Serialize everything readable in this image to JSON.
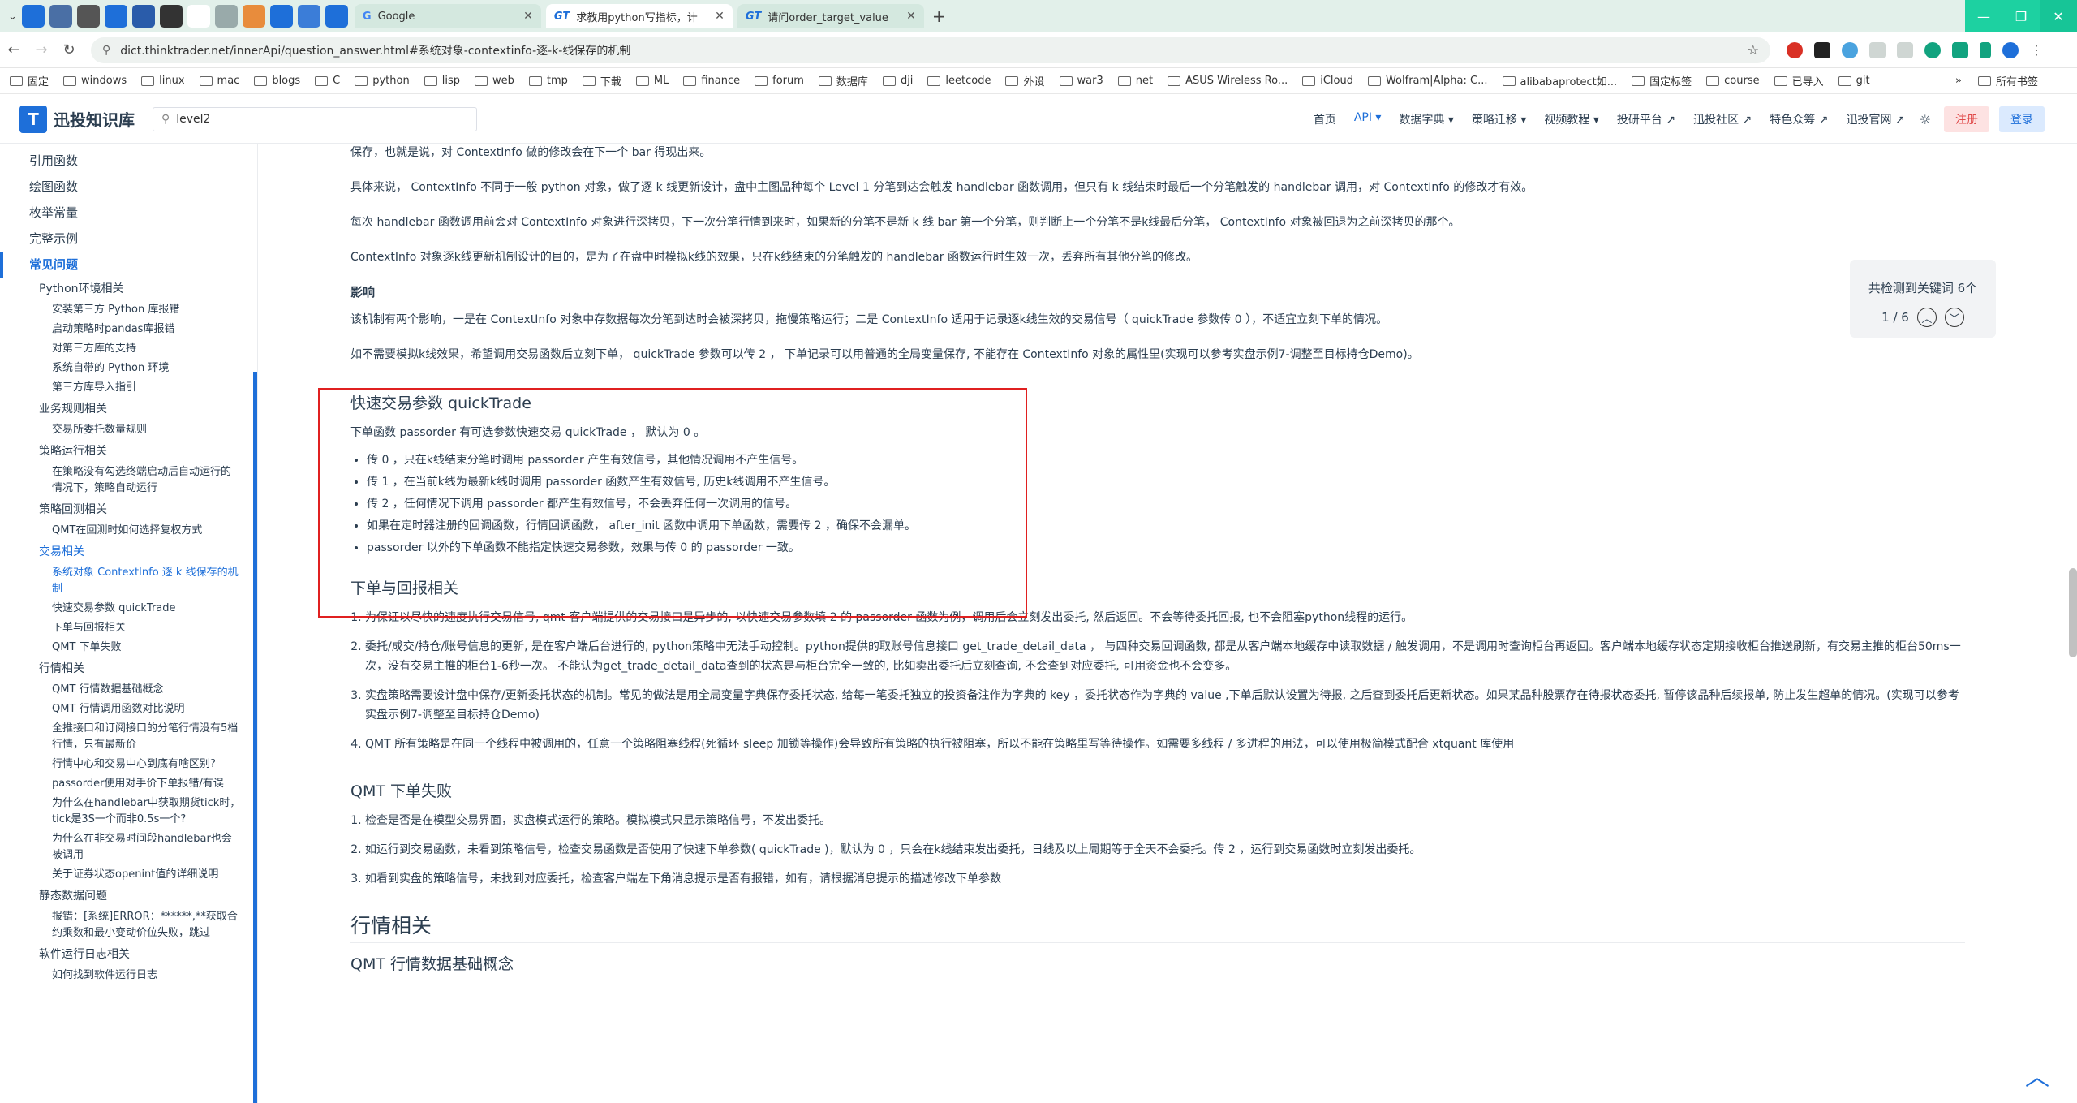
{
  "browser": {
    "tabs": [
      {
        "label": "Google",
        "active": false
      },
      {
        "label": "求教用python写指标，计算出…",
        "active": true
      },
      {
        "label": "请问order_target_value的使用…",
        "active": false
      }
    ],
    "pinned_tabs": [
      "",
      "",
      "",
      "",
      "",
      "",
      "",
      "",
      "",
      "",
      "",
      ""
    ],
    "url": "dict.thinktrader.net/innerApi/question_answer.html#系统对象-contextinfo-逐-k-线保存的机制",
    "bookmarks": [
      "固定",
      "windows",
      "linux",
      "mac",
      "blogs",
      "C",
      "python",
      "lisp",
      "web",
      "tmp",
      "下载",
      "ML",
      "finance",
      "forum",
      "数据库",
      "dji",
      "leetcode",
      "外设",
      "war3",
      "net",
      "ASUS Wireless Ro...",
      "iCloud",
      "Wolfram|Alpha: C...",
      "alibabaprotect如...",
      "固定标签",
      "course",
      "已导入",
      "git"
    ],
    "bookmarks_all": "所有书签"
  },
  "site": {
    "logo_text": "迅投知识库",
    "search_value": "level2",
    "nav": [
      {
        "label": "首页",
        "active": false
      },
      {
        "label": "API ▾",
        "active": true
      },
      {
        "label": "数据字典 ▾",
        "active": false
      },
      {
        "label": "策略迁移 ▾",
        "active": false
      },
      {
        "label": "视频教程 ▾",
        "active": false
      },
      {
        "label": "投研平台 ↗",
        "active": false
      },
      {
        "label": "迅投社区 ↗",
        "active": false
      },
      {
        "label": "特色众筹 ↗",
        "active": false
      },
      {
        "label": "迅投官网 ↗",
        "active": false
      }
    ],
    "register": "注册",
    "login": "登录"
  },
  "sidebar": {
    "top_items": [
      "引用函数",
      "绘图函数",
      "枚举常量",
      "完整示例",
      "常见问题"
    ],
    "groups": [
      {
        "title": "Python环境相关",
        "leaves": [
          "安装第三方 Python 库报错",
          "启动策略时pandas库报错",
          "对第三方库的支持",
          "系统自带的 Python 环境",
          "第三方库导入指引"
        ]
      },
      {
        "title": "业务规则相关",
        "leaves": [
          "交易所委托数量规则"
        ]
      },
      {
        "title": "策略运行相关",
        "leaves": [
          "在策略没有勾选终端启动后自动运行的情况下，策略自动运行"
        ]
      },
      {
        "title": "策略回测相关",
        "leaves": [
          "QMT在回测时如何选择复权方式"
        ]
      },
      {
        "title": "交易相关",
        "leaves": [
          "系统对象 ContextInfo 逐 k 线保存的机制",
          "快速交易参数 quickTrade",
          "下单与回报相关",
          "QMT 下单失败"
        ]
      },
      {
        "title": "行情相关",
        "leaves": [
          "QMT 行情数据基础概念",
          "QMT 行情调用函数对比说明",
          "全推接口和订阅接口的分笔行情没有5档行情，只有最新价",
          "行情中心和交易中心到底有啥区别?",
          "passorder使用对手价下单报错/有误",
          "为什么在handlebar中获取期货tick时，tick是3S一个而非0.5s一个?",
          "为什么在非交易时间段handlebar也会被调用",
          "关于证券状态openint值的详细说明"
        ]
      },
      {
        "title": "静态数据问题",
        "leaves": [
          "报错：[系统]ERROR：******,**获取合约乘数和最小变动价位失败，跳过"
        ]
      },
      {
        "title": "软件运行日志相关",
        "leaves": [
          "如何找到软件运行日志"
        ]
      }
    ]
  },
  "content": {
    "p0": "保存，也就是说，对 ContextInfo 做的修改会在下一个 bar 得现出来。",
    "p1": "具体来说， ContextInfo 不同于一般 python 对象，做了逐 k 线更新设计，盘中主图品种每个 Level 1 分笔到达会触发 handlebar 函数调用，但只有 k 线结束时最后一个分笔触发的 handlebar 调用，对 ContextInfo 的修改才有效。",
    "p2": "每次 handlebar 函数调用前会对 ContextInfo 对象进行深拷贝，下一次分笔行情到来时，如果新的分笔不是新 k 线 bar 第一个分笔，则判断上一个分笔不是k线最后分笔， ContextInfo 对象被回退为之前深拷贝的那个。",
    "p3": "ContextInfo 对象逐k线更新机制设计的目的，是为了在盘中时模拟k线的效果，只在k线结束的分笔触发的 handlebar 函数运行时生效一次，丢弃所有其他分笔的修改。",
    "impact_title": "影响",
    "p4": "该机制有两个影响，一是在 ContextInfo 对象中存数据每次分笔到达时会被深拷贝，拖慢策略运行；二是 ContextInfo 适用于记录逐k线生效的交易信号（ quickTrade 参数传 0 ），不适宜立刻下单的情况。",
    "p5": "如不需要模拟k线效果，希望调用交易函数后立刻下单， quickTrade 参数可以传 2 ， 下单记录可以用普通的全局变量保存, 不能存在 ContextInfo 对象的属性里(实现可以参考实盘示例7-调整至目标持仓Demo)。",
    "qt_title": "快速交易参数 quickTrade",
    "qt_intro": "下单函数 passorder 有可选参数快速交易 quickTrade ， 默认为 0 。",
    "qt_items": [
      "传 0 ，只在k线结束分笔时调用 passorder 产生有效信号，其他情况调用不产生信号。",
      "传 1 ，在当前k线为最新k线时调用 passorder 函数产生有效信号, 历史k线调用不产生信号。",
      "传 2 ，任何情况下调用 passorder 都产生有效信号，不会丢弃任何一次调用的信号。",
      "如果在定时器注册的回调函数，行情回调函数， after_init 函数中调用下单函数，需要传 2 ，确保不会漏单。",
      "passorder 以外的下单函数不能指定快速交易参数，效果与传 0 的 passorder 一致。"
    ],
    "order_title": "下单与回报相关",
    "order_items": [
      "为保证以尽快的速度执行交易信号, qmt 客户端提供的交易接口是异步的, 以快速交易参数填 2 的 passorder 函数为例，调用后会立刻发出委托, 然后返回。不会等待委托回报, 也不会阻塞python线程的运行。",
      "委托/成交/持仓/账号信息的更新, 是在客户端后台进行的, python策略中无法手动控制。python提供的取账号信息接口 get_trade_detail_data ， 与四种交易回调函数, 都是从客户端本地缓存中读取数据 / 触发调用，不是调用时查询柜台再返回。客户端本地缓存状态定期接收柜台推送刷新，有交易主推的柜台50ms一次，没有交易主推的柜台1-6秒一次。 不能认为get_trade_detail_data查到的状态是与柜台完全一致的, 比如卖出委托后立刻查询, 不会查到对应委托, 可用资金也不会变多。",
      "实盘策略需要设计盘中保存/更新委托状态的机制。常见的做法是用全局变量字典保存委托状态, 给每一笔委托独立的投资备注作为字典的 key ，委托状态作为字典的 value ,下单后默认设置为待报, 之后查到委托后更新状态。如果某品种股票存在待报状态委托, 暂停该品种后续报单, 防止发生超单的情况。(实现可以参考实盘示例7-调整至目标持仓Demo)",
      "QMT 所有策略是在同一个线程中被调用的，任意一个策略阻塞线程(死循环 sleep 加锁等操作)会导致所有策略的执行被阻塞，所以不能在策略里写等待操作。如需要多线程 / 多进程的用法，可以使用极简模式配合 xtquant 库使用"
    ],
    "fail_title": "QMT 下单失败",
    "fail_items": [
      "检查是否是在模型交易界面，实盘模式运行的策略。模拟模式只显示策略信号，不发出委托。",
      "如运行到交易函数，未看到策略信号，检查交易函数是否使用了快速下单参数( quickTrade )，默认为 0 ，只会在k线结束发出委托，日线及以上周期等于全天不会委托。传 2 ，运行到交易函数时立刻发出委托。",
      "如看到实盘的策略信号，未找到对应委托，检查客户端左下角消息提示是否有报错，如有，请根据消息提示的描述修改下单参数"
    ],
    "market_title": "行情相关",
    "market_sub": "QMT 行情数据基础概念"
  },
  "match_panel": {
    "count_text": "共检测到关键词 6个",
    "position_text": "1 / 6"
  },
  "colors": {
    "accent": "#1e6fd9",
    "highlight_box": "#e02020"
  }
}
